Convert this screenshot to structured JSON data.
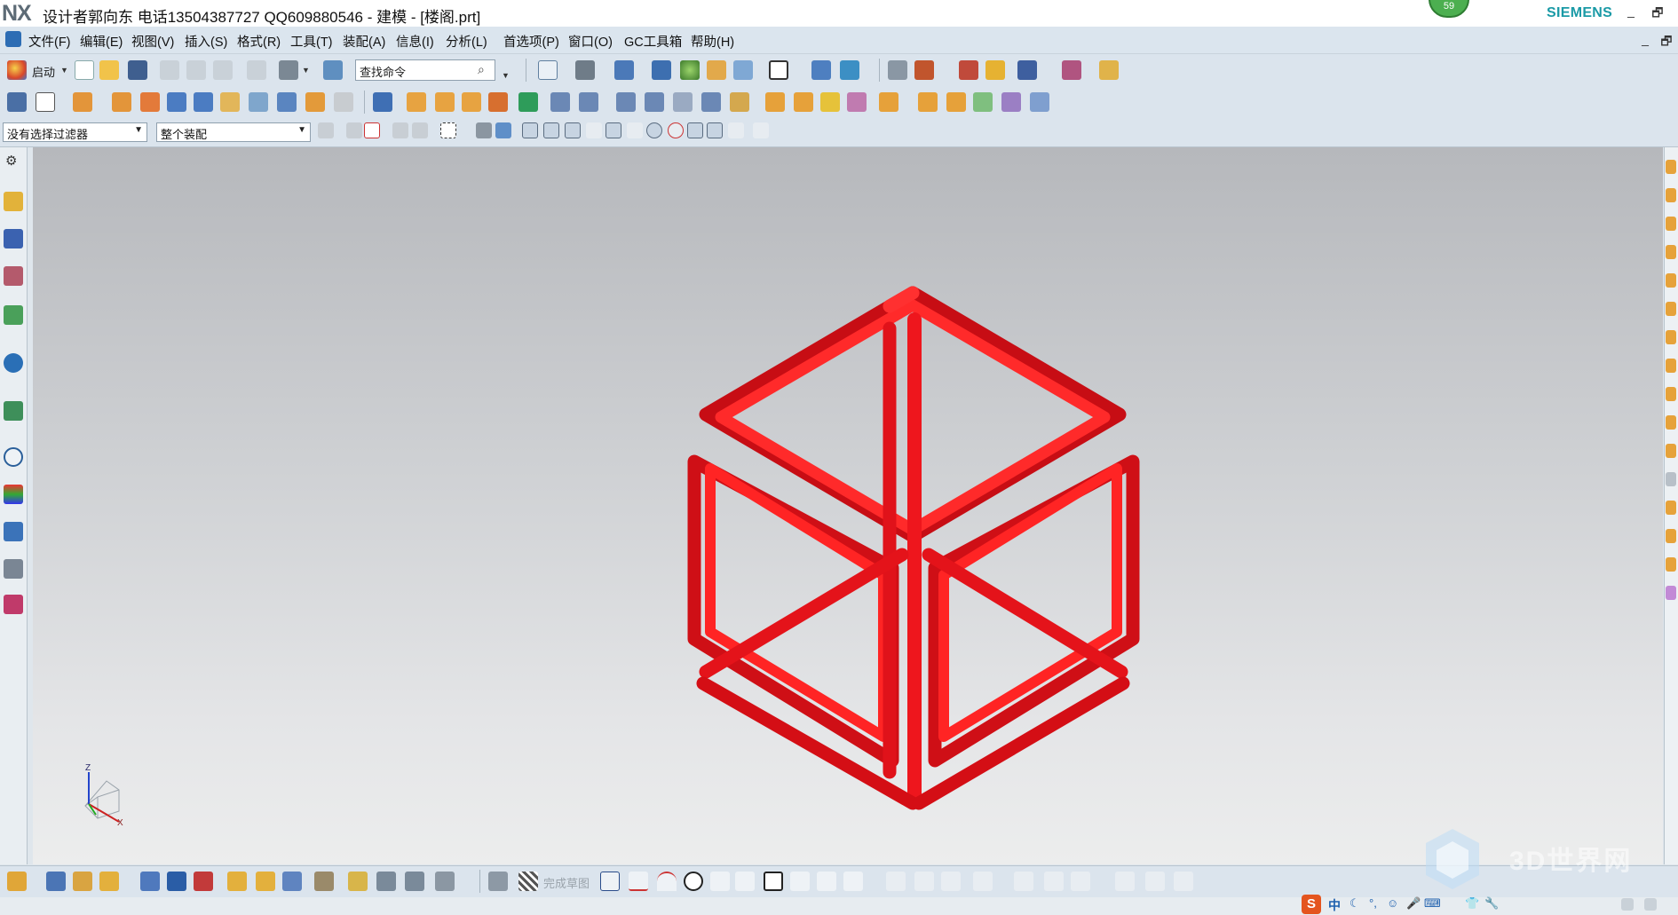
{
  "window": {
    "logo": "NX",
    "title": "设计者郭向东  电话13504387727  QQ609880546 - 建模 - [楼阁.prt]",
    "brand": "SIEMENS",
    "badge_count": "59",
    "min_symbol": "_",
    "restore_symbol": "🗗"
  },
  "menubar": {
    "items": [
      "文件(F)",
      "编辑(E)",
      "视图(V)",
      "插入(S)",
      "格式(R)",
      "工具(T)",
      "装配(A)",
      "信息(I)",
      "分析(L)",
      "首选项(P)",
      "窗口(O)",
      "GC工具箱",
      "帮助(H)"
    ]
  },
  "toolbar": {
    "start_label": "启动",
    "search_placeholder": "查找命令",
    "selection_filter": "没有选择过滤器",
    "assembly_scope": "整个装配"
  },
  "bottom_toolbar": {
    "finish_sketch_label": "完成草图"
  },
  "ime": {
    "mode": "中"
  },
  "watermark": {
    "text": "3D世界网"
  },
  "model": {
    "name": "楼阁.prt",
    "color": "#e8141b",
    "shape": "rounded-cube-frame"
  },
  "triad": {
    "z_label": "Z",
    "x_label": "X"
  },
  "colors": {
    "brand": "#1a9aa6",
    "accent": "#2d6db4",
    "model": "#e8141b"
  }
}
